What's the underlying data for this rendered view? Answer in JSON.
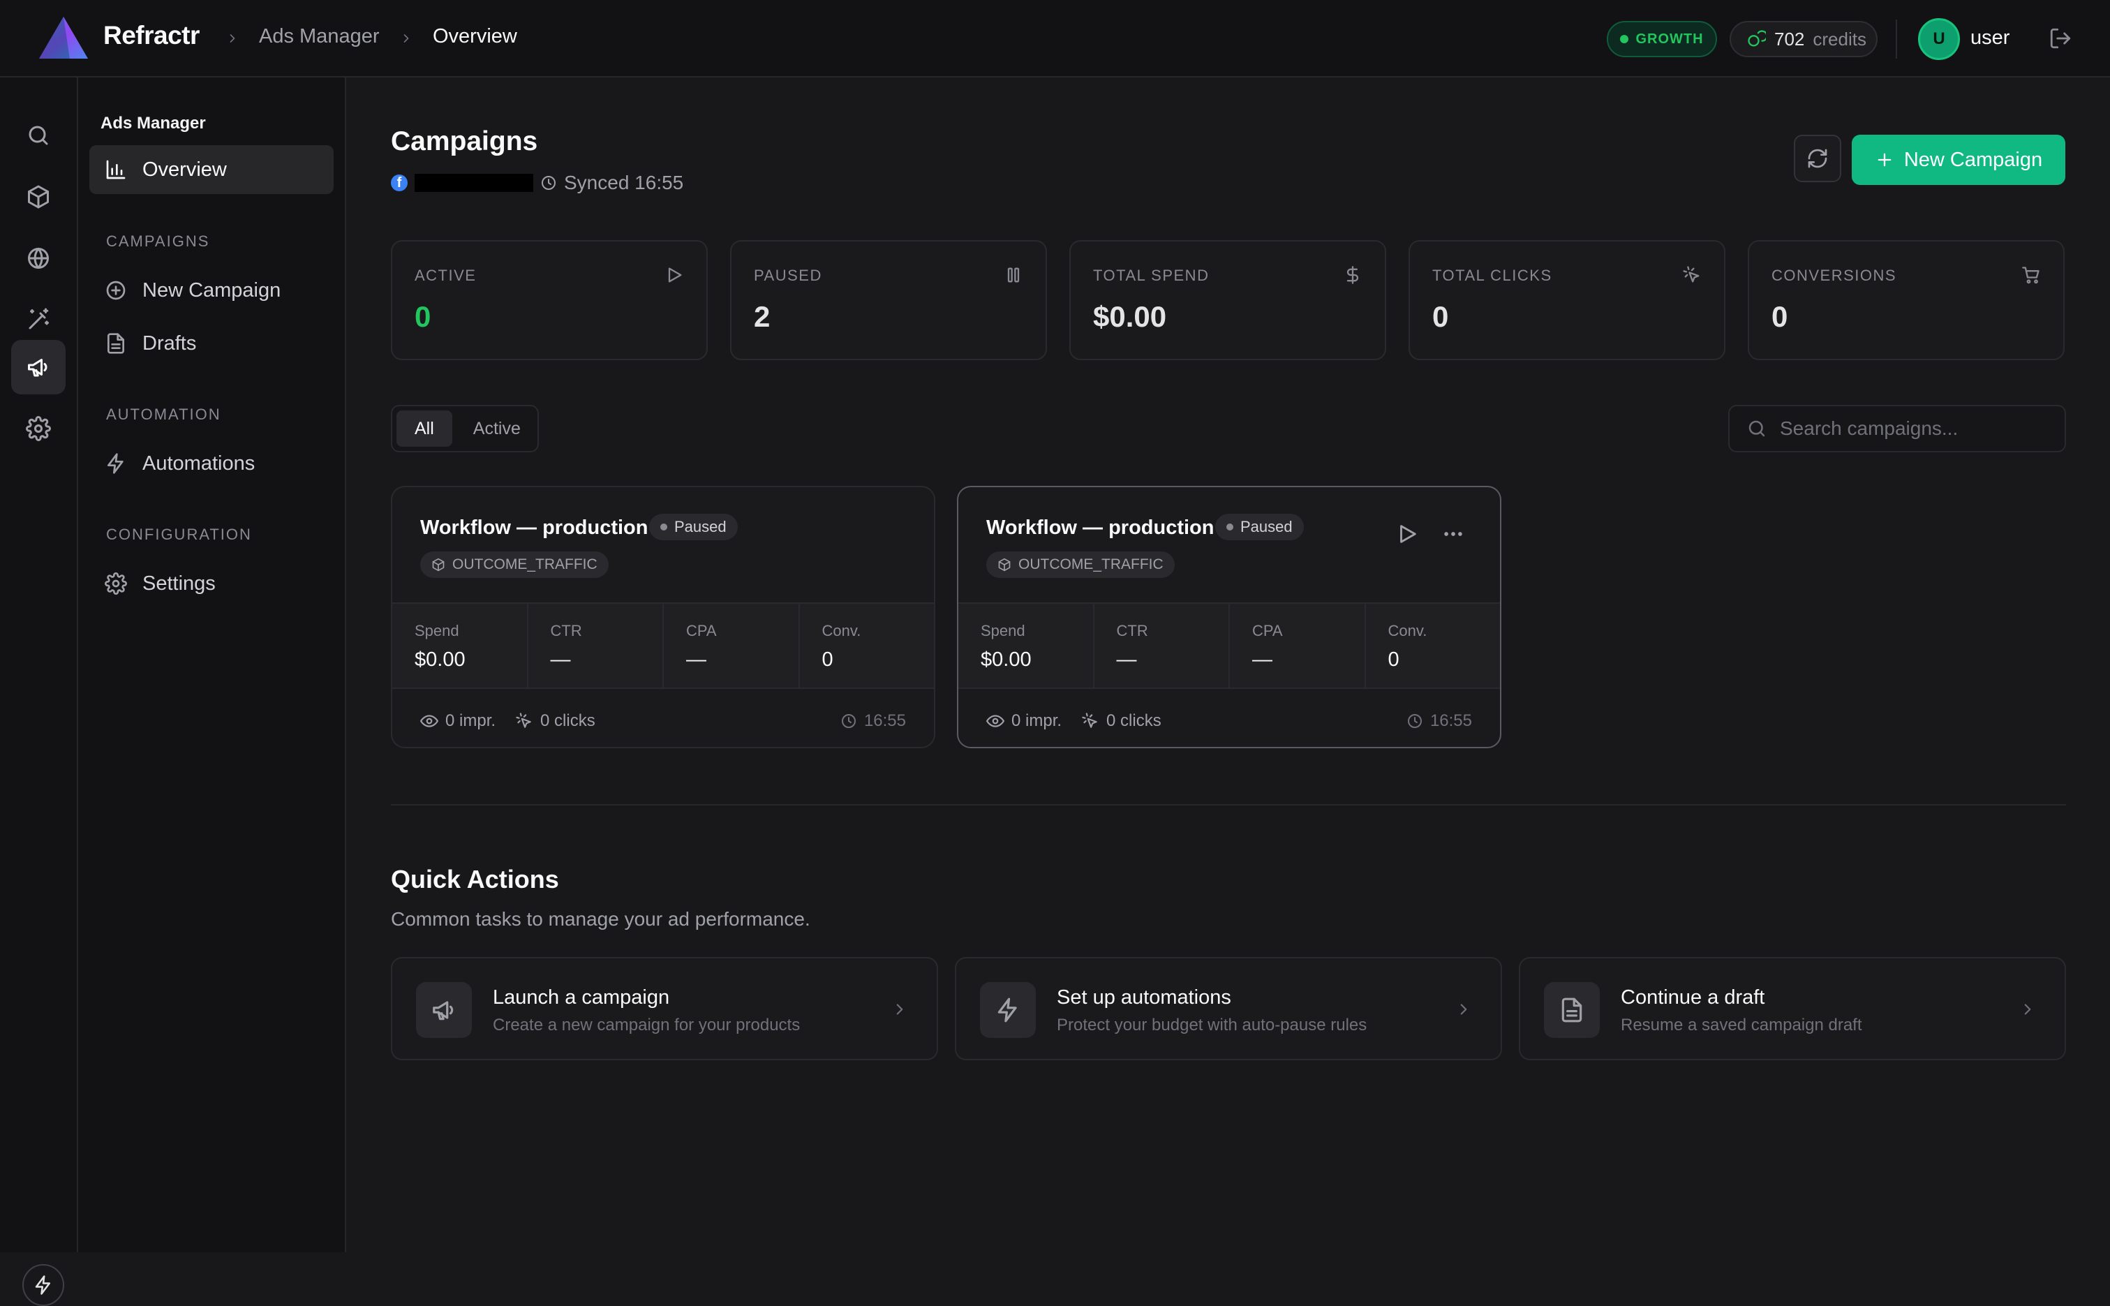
{
  "app": {
    "brand": "Refractr"
  },
  "breadcrumb": [
    "Ads Manager",
    "Overview"
  ],
  "header": {
    "plan": "GROWTH",
    "credits_value": "702",
    "credits_label": "credits",
    "avatar_initial": "U",
    "username": "user"
  },
  "nav": {
    "title": "Ads Manager",
    "overview": "Overview",
    "sections": {
      "campaigns": "CAMPAIGNS",
      "automation": "AUTOMATION",
      "configuration": "CONFIGURATION"
    },
    "new_campaign": "New Campaign",
    "drafts": "Drafts",
    "automations": "Automations",
    "settings": "Settings"
  },
  "page": {
    "title": "Campaigns",
    "synced": "Synced 16:55",
    "new_button": "New Campaign"
  },
  "stats": [
    {
      "label": "ACTIVE",
      "value": "0",
      "icon": "play-icon"
    },
    {
      "label": "PAUSED",
      "value": "2",
      "icon": "pause-icon"
    },
    {
      "label": "TOTAL SPEND",
      "value": "$0.00",
      "icon": "dollar-icon"
    },
    {
      "label": "TOTAL CLICKS",
      "value": "0",
      "icon": "pointer-click-icon"
    },
    {
      "label": "CONVERSIONS",
      "value": "0",
      "icon": "cart-icon"
    }
  ],
  "filters": {
    "all": "All",
    "active": "Active"
  },
  "search": {
    "placeholder": "Search campaigns..."
  },
  "campaigns": [
    {
      "name": "Workflow — production",
      "status": "Paused",
      "objective": "OUTCOME_TRAFFIC",
      "metrics": {
        "spend_label": "Spend",
        "spend": "$0.00",
        "ctr_label": "CTR",
        "ctr": "—",
        "cpa_label": "CPA",
        "cpa": "—",
        "conv_label": "Conv.",
        "conv": "0"
      },
      "impressions": "0 impr.",
      "clicks": "0 clicks",
      "time": "16:55"
    },
    {
      "name": "Workflow — production",
      "status": "Paused",
      "objective": "OUTCOME_TRAFFIC",
      "metrics": {
        "spend_label": "Spend",
        "spend": "$0.00",
        "ctr_label": "CTR",
        "ctr": "—",
        "cpa_label": "CPA",
        "cpa": "—",
        "conv_label": "Conv.",
        "conv": "0"
      },
      "impressions": "0 impr.",
      "clicks": "0 clicks",
      "time": "16:55"
    }
  ],
  "quick_actions": {
    "title": "Quick Actions",
    "subtitle": "Common tasks to manage your ad performance.",
    "items": [
      {
        "name": "Launch a campaign",
        "desc": "Create a new campaign for your products",
        "icon": "megaphone-icon"
      },
      {
        "name": "Set up automations",
        "desc": "Protect your budget with auto-pause rules",
        "icon": "lightning-icon"
      },
      {
        "name": "Continue a draft",
        "desc": "Resume a saved campaign draft",
        "icon": "document-icon"
      }
    ]
  },
  "colors": {
    "accent": "#10b981",
    "background": "#18181a",
    "sidebar": "#121214"
  }
}
